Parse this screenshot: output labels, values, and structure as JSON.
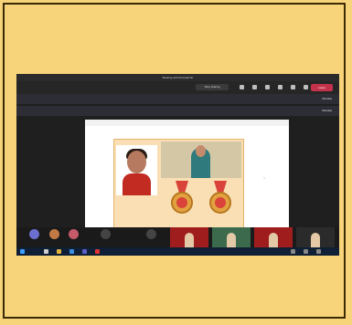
{
  "window": {
    "title": "Meeting with Principal Sir",
    "leave_label": "Leave"
  },
  "toolbar": {
    "left_label": "",
    "share_label": "Stop sharing"
  },
  "banners": [
    {
      "text": "",
      "dismiss": "Dismiss"
    },
    {
      "text": "",
      "dismiss": "Dismiss"
    }
  ],
  "stage": {
    "bar_text": ""
  },
  "presenter_label": "",
  "participants": [
    {
      "name": "",
      "color": "#6d6fd0"
    },
    {
      "name": "",
      "color": "#c27a45"
    },
    {
      "name": "",
      "color": "#c45a6a"
    }
  ],
  "colors": {
    "leave": "#c4314b",
    "accent": "#6264a7"
  }
}
